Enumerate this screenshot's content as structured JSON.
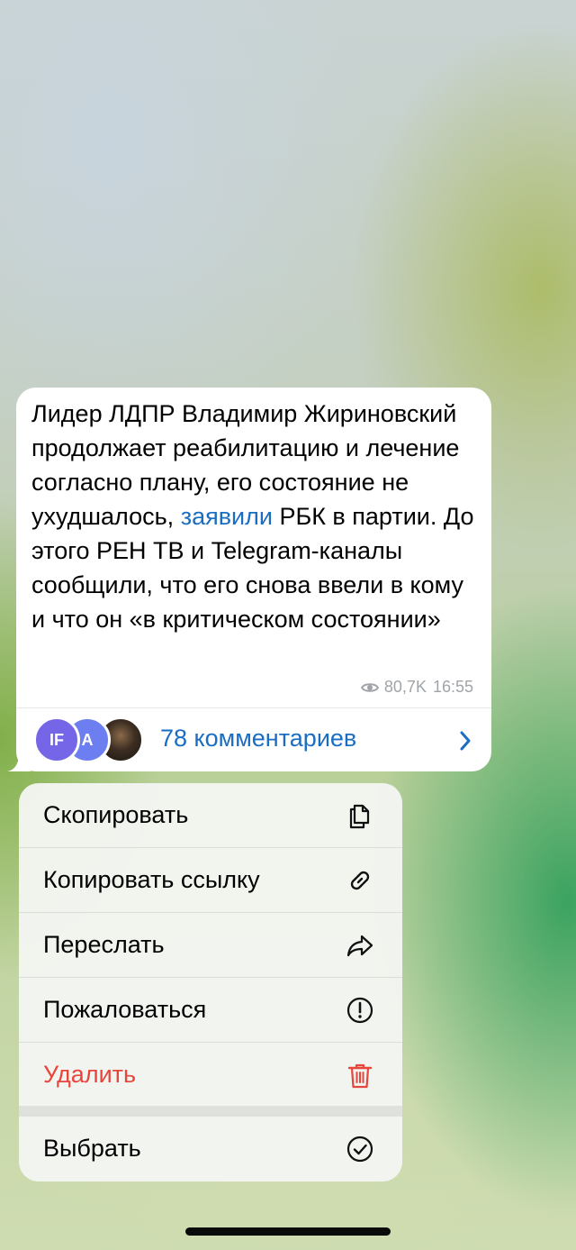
{
  "message": {
    "text_before_link": "Лидер ЛДПР Владимир Жириновский продолжает реабилитацию и лечение согласно плану, его состояние не ухудшалось, ",
    "link_text": "заявили",
    "text_after_link": " РБК в партии. До этого РЕН ТВ и Telegram-каналы сообщили, что его снова ввели в кому и что он «в критическом состоянии»",
    "views": "80,7K",
    "time": "16:55",
    "link_color": "#1a6dc2"
  },
  "comments": {
    "label": "78 комментариев",
    "avatars": [
      {
        "initials": "IF",
        "color": "#7566e8"
      },
      {
        "initials": "A",
        "color": "#6d7ff0"
      },
      {
        "initials": "",
        "type": "photo"
      }
    ]
  },
  "menu": {
    "items": [
      {
        "label": "Скопировать",
        "icon": "copy-icon"
      },
      {
        "label": "Копировать ссылку",
        "icon": "link-icon"
      },
      {
        "label": "Переслать",
        "icon": "forward-icon"
      },
      {
        "label": "Пожаловаться",
        "icon": "report-icon"
      },
      {
        "label": "Удалить",
        "icon": "trash-icon",
        "color": "#e8453c"
      }
    ],
    "secondary_items": [
      {
        "label": "Выбрать",
        "icon": "checkmark-circle-icon"
      }
    ]
  }
}
